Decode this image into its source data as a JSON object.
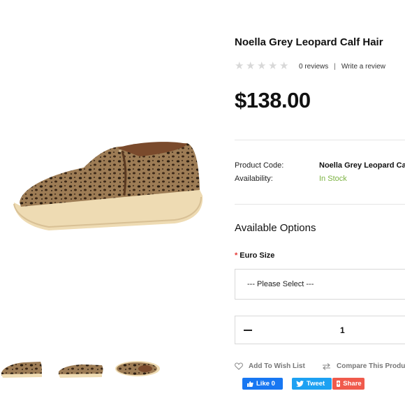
{
  "product": {
    "title": "Noella Grey Leopard Calf Hair",
    "rating": {
      "stars": 0,
      "max": 5,
      "reviews_text": "0 reviews",
      "separator": "|",
      "write_review": "Write a review"
    },
    "price": "$138.00",
    "details": {
      "code_label": "Product Code:",
      "code_value": "Noella Grey Leopard Ca",
      "availability_label": "Availability:",
      "availability_value": "In Stock"
    }
  },
  "options": {
    "title": "Available Options",
    "size": {
      "required_mark": "*",
      "label": "Euro Size",
      "placeholder": "--- Please Select ---"
    },
    "quantity": {
      "minus": "—",
      "value": "1"
    }
  },
  "actions": {
    "wishlist": "Add To Wish List",
    "compare": "Compare This Produc"
  },
  "social": {
    "like": "Like 0",
    "tweet": "Tweet",
    "share": "Share"
  },
  "colors": {
    "in_stock": "#7cb342",
    "facebook": "#1877f2",
    "twitter": "#1da1f2",
    "share": "#f05a4c"
  }
}
